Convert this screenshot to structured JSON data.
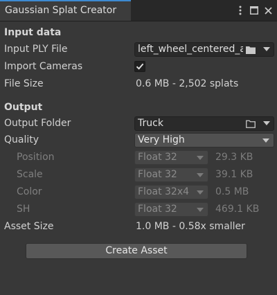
{
  "window": {
    "tab_title": "Gaussian Splat Creator",
    "icons": [
      "kebab-menu-icon",
      "maximize-icon",
      "close-icon"
    ]
  },
  "input": {
    "header": "Input data",
    "ply_label": "Input PLY File",
    "ply_value": "left_wheel_centered_and",
    "cameras_label": "Import Cameras",
    "cameras_checked": true,
    "size_label": "File Size",
    "size_value": "0.6 MB - 2,502 splats"
  },
  "output": {
    "header": "Output",
    "folder_label": "Output Folder",
    "folder_value": "Truck",
    "quality_label": "Quality",
    "quality_value": "Very High",
    "params": [
      {
        "label": "Position",
        "format": "Float 32",
        "size": "29.3 KB"
      },
      {
        "label": "Scale",
        "format": "Float 32",
        "size": "39.1 KB"
      },
      {
        "label": "Color",
        "format": "Float 32x4",
        "size": "0.5 MB"
      },
      {
        "label": "SH",
        "format": "Float 32",
        "size": "469.1 KB"
      }
    ],
    "asset_size_label": "Asset Size",
    "asset_size_value": "1.0 MB - 0.58x smaller"
  },
  "actions": {
    "create_label": "Create Asset"
  },
  "colors": {
    "accent": "#3d8ad1",
    "background": "#383838"
  }
}
